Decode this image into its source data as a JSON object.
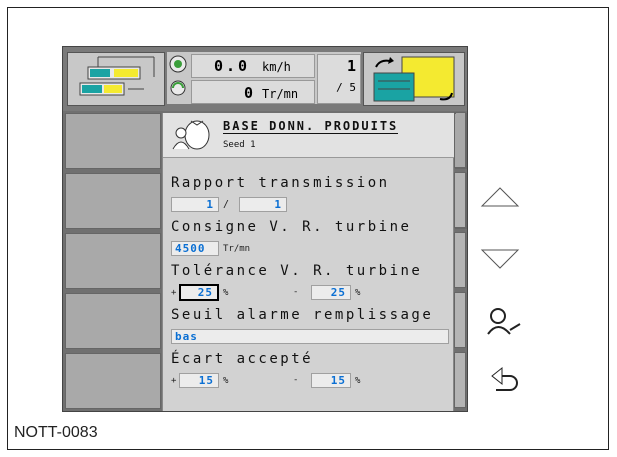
{
  "top": {
    "speed_value": "0.0",
    "speed_unit": "km/h",
    "rpm_value": "0",
    "rpm_unit": "Tr/mn",
    "page_current": "1",
    "page_total": "/ 5"
  },
  "header": {
    "title": "BASE DONN. PRODUITS",
    "subtitle": "Seed 1"
  },
  "fields": {
    "rapport_label": "Rapport transmission",
    "rapport_a": "1",
    "rapport_sep": "/",
    "rapport_b": "1",
    "consigne_label": "Consigne V. R. turbine",
    "consigne_value": "4500",
    "consigne_unit": "Tr/mn",
    "tolerance_label": "Tolérance V. R. turbine",
    "tol_plus_sign": "+",
    "tol_plus_value": "25",
    "tol_plus_unit": "%",
    "tol_minus_sign": "-",
    "tol_minus_value": "25",
    "tol_minus_unit": "%",
    "seuil_label": "Seuil alarme remplissage",
    "seuil_value": "bas",
    "ecart_label": "Écart accepté",
    "ecart_plus_sign": "+",
    "ecart_plus_value": "15",
    "ecart_plus_unit": "%",
    "ecart_minus_sign": "-",
    "ecart_minus_value": "15",
    "ecart_minus_unit": "%"
  },
  "caption": "NOTT-0083",
  "colors": {
    "value_text": "#0a6fd3",
    "panel_bg": "#d2d2d2",
    "side_button": "#b5b5b5"
  },
  "icons": {
    "up": "arrow-up-icon",
    "down": "arrow-down-icon",
    "operator": "operator-icon",
    "back": "back-icon"
  }
}
